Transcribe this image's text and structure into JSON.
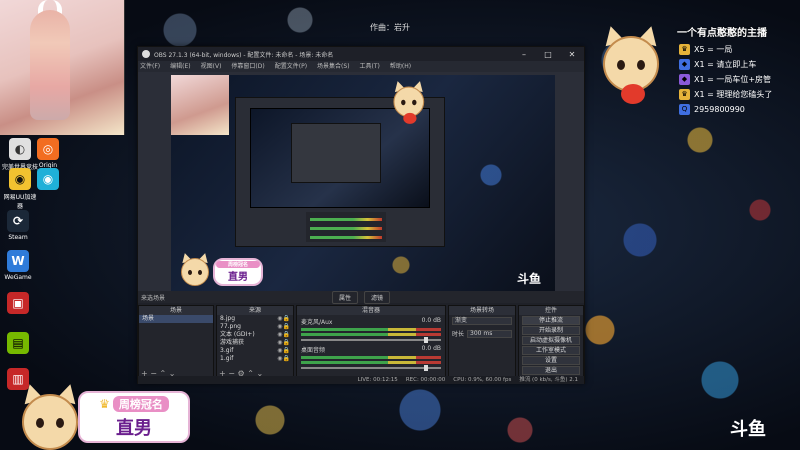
{
  "song_credit": "作曲：岩升",
  "webcam": {},
  "desktop_icons": [
    {
      "label": "完美世界竞技平台",
      "glyph": "◐",
      "color": "#e0e0e0"
    },
    {
      "label": "Origin",
      "glyph": "◎",
      "color": "#f26d21"
    },
    {
      "label": "网易UU加速器",
      "glyph": "◉",
      "color": "#1fb0d8"
    },
    {
      "label": "Steam",
      "glyph": "⟳",
      "color": "#1b2838"
    },
    {
      "label": "WeGame",
      "glyph": "W",
      "color": "#2f7bd9"
    },
    {
      "label": "",
      "glyph": "▣",
      "color": "#c62828"
    },
    {
      "label": "",
      "glyph": "▤",
      "color": "#76b900"
    },
    {
      "label": "",
      "glyph": "▥",
      "color": "#c62828"
    }
  ],
  "overlay": {
    "title": "一个有点憨憨的主播",
    "perks": [
      {
        "icon": "♛",
        "text": "X5 = 一局"
      },
      {
        "icon": "◆",
        "text": "X1 = 请立即上车"
      },
      {
        "icon": "◆",
        "text": "X1 = 一局车位+房管"
      },
      {
        "icon": "♛",
        "text": "X1 = 理理给您磕头了"
      }
    ],
    "qq": "2959800990"
  },
  "crown_badge": {
    "top_label": "周榜冠名",
    "name": "直男"
  },
  "obs": {
    "title": "OBS 27.1.3 (64-bit, windows) - 配置文件: 未命名 - 场景: 未命名",
    "menu": [
      "文件(F)",
      "编辑(E)",
      "视图(V)",
      "停靠窗口(D)",
      "配置文件(P)",
      "场景集合(S)",
      "工具(T)",
      "帮助(H)"
    ],
    "preview_logo": "斗鱼",
    "dock": {
      "scene_label": "来选场景",
      "tabs": [
        "属性",
        "滤镜"
      ],
      "scenes_header": "场景",
      "scenes": [
        "场景"
      ],
      "sources_header": "来源",
      "sources": [
        "8.jpg",
        "77.png",
        "文本 (GDI+)",
        "游戏捕获",
        "3.gif",
        "1.gif"
      ],
      "mixer_header": "混音器",
      "mixer": [
        {
          "name": "麦克风/Aux",
          "db": "0.0 dB"
        },
        {
          "name": "桌面音频",
          "db": "0.0 dB"
        }
      ],
      "transitions_header": "场景转场",
      "transition_type": "渐变",
      "duration_label": "时长",
      "duration_value": "300 ms",
      "controls_header": "控件",
      "controls": [
        "停止推流",
        "开始录制",
        "启动虚拟摄像机",
        "工作室模式",
        "设置",
        "退出"
      ]
    },
    "status": [
      "LIVE: 00:12:15",
      "REC: 00:00:00",
      "CPU: 0.9%, 60.00 fps",
      "推流 (0 kb/s, 斗鱼) 2.1"
    ]
  },
  "desktop_logo": "斗鱼"
}
